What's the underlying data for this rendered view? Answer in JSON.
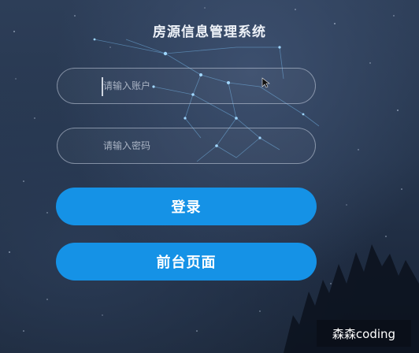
{
  "app": {
    "title": "房源信息管理系统"
  },
  "form": {
    "account_placeholder": "请输入账户",
    "password_placeholder": "请输入密码"
  },
  "buttons": {
    "login_label": "登录",
    "front_label": "前台页面"
  },
  "watermark": {
    "text": "森森coding"
  },
  "colors": {
    "button_bg": "#1592e6",
    "constellation": "#7ec8ff",
    "background": "#26364e"
  }
}
